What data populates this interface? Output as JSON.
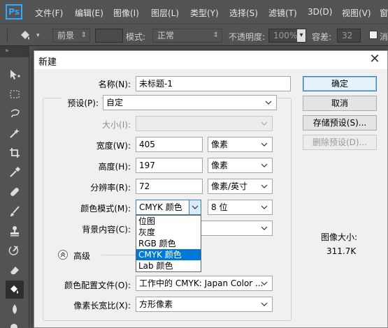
{
  "app": {
    "logo": "Ps",
    "menu": [
      "文件(F)",
      "编辑(E)",
      "图像(I)",
      "图层(L)",
      "类型(Y)",
      "选择(S)",
      "滤镜(T)",
      "3D(D)",
      "视图(V)",
      "窗"
    ]
  },
  "options_bar": {
    "tool_icon": "paint-bucket-icon",
    "fill_source": "前景",
    "mode_label": "模式:",
    "mode_value": "正常",
    "opacity_label": "不透明度:",
    "opacity_value": "100%",
    "tolerance_label": "容差:",
    "tolerance_value": "32",
    "antialias_label": "消"
  },
  "toolbar": {
    "header": "»",
    "tools": [
      "move-icon",
      "marquee-icon",
      "lasso-icon",
      "magic-wand-icon",
      "crop-icon",
      "eyedropper-icon",
      "healing-brush-icon",
      "brush-icon",
      "clone-stamp-icon",
      "history-brush-icon",
      "eraser-icon",
      "paint-bucket-icon",
      "blur-icon",
      "dodge-icon"
    ],
    "active_tool": "paint-bucket-icon"
  },
  "dialog": {
    "title": "新建",
    "name_label": "名称(N):",
    "name_value": "未标题-1",
    "preset_label": "预设(P):",
    "preset_value": "自定",
    "size_label": "大小(I):",
    "size_value": "",
    "width_label": "宽度(W):",
    "width_value": "405",
    "width_unit": "像素",
    "height_label": "高度(H):",
    "height_value": "197",
    "height_unit": "像素",
    "resolution_label": "分辨率(R):",
    "resolution_value": "72",
    "resolution_unit": "像素/英寸",
    "color_mode_label": "颜色模式(M):",
    "color_mode_value": "CMYK 颜色",
    "bit_depth_value": "8 位",
    "background_label": "背景内容(C):",
    "color_mode_options": [
      "位图",
      "灰度",
      "RGB 颜色",
      "CMYK 颜色",
      "Lab 颜色"
    ],
    "color_mode_selected": "CMYK 颜色",
    "advanced_label": "高级",
    "color_profile_label": "颜色配置文件(O):",
    "color_profile_value": "工作中的 CMYK: Japan Color ...",
    "pixel_aspect_label": "像素长宽比(X):",
    "pixel_aspect_value": "方形像素",
    "buttons": {
      "ok": "确定",
      "cancel": "取消",
      "save_preset": "存储预设(S)...",
      "delete_preset": "删除预设(D)..."
    },
    "image_size_label": "图像大小:",
    "image_size_value": "311.7K"
  },
  "colors": {
    "ps_blue": "#31a8ff",
    "chrome_bg": "#535353",
    "dialog_bg": "#f0f0f0",
    "selection_blue": "#0078d7"
  }
}
